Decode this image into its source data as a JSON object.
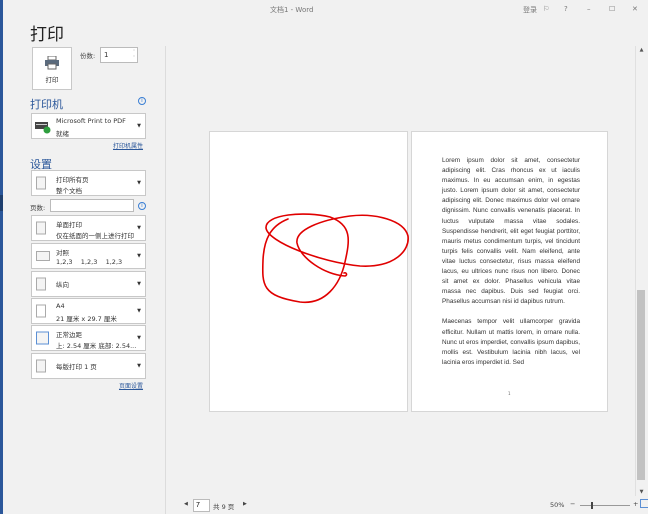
{
  "window": {
    "title": "文档1 - Word",
    "signin": "登录",
    "help": "?",
    "minimize": "–",
    "maximize": "☐",
    "close": "✕"
  },
  "page_title": "打印",
  "print_button": {
    "label": "打印",
    "icon": "printer-icon"
  },
  "copies": {
    "label": "份数:",
    "value": "1"
  },
  "printer": {
    "heading": "打印机",
    "name": "Microsoft Print to PDF",
    "status": "就绪",
    "properties_link": "打印机属性"
  },
  "settings": {
    "heading": "设置",
    "pages_label": "页数:",
    "pages_value": "",
    "items": [
      {
        "line1": "打印所有页",
        "line2": "整个文档"
      },
      {
        "line1": "单面打印",
        "line2": "仅在纸面的一侧上进行打印"
      },
      {
        "line1": "对照",
        "line2": "1,2,3    1,2,3    1,2,3"
      },
      {
        "line1": "纵向",
        "line2": ""
      },
      {
        "line1": "A4",
        "line2": "21 厘米 x 29.7 厘米"
      },
      {
        "line1": "正常边距",
        "line2": "上: 2.54 厘米 底部: 2.54..."
      },
      {
        "line1": "每版打印 1 页",
        "line2": ""
      }
    ],
    "page_setup_link": "页面设置"
  },
  "preview": {
    "paragraphs": [
      "Lorem ipsum dolor sit amet, consectetur adipiscing elit. Cras rhoncus ex ut iaculis maximus. In eu accumsan enim, in egestas justo. Lorem ipsum dolor sit amet, consectetur adipiscing elit. Donec maximus dolor vel ornare dignissim. Nunc convallis venenatis placerat. In luctus vulputate massa vitae sodales. Suspendisse hendrerit, elit eget feugiat porttitor, mauris metus condimentum turpis, vel tincidunt turpis felis convallis velit. Nam eleifend, ante vitae luctus consectetur, risus massa eleifend lacus, eu ultrices nunc risus non libero. Donec sit amet ex dolor. Phasellus vehicula vitae massa nec dapibus. Duis sed feugiat orci. Phasellus accumsan nisi id dapibus rutrum.",
      "Maecenas tempor velit ullamcorper gravida efficitur. Nullam ut mattis lorem, in ornare nulla. Nunc ut eros imperdiet, convallis ipsum dapibus, mollis est. Vestibulum lacinia nibh lacus, vel lacinia eros imperdiet id. Sed"
    ],
    "page_number": "1",
    "ink_color": "#e00000"
  },
  "status": {
    "current_page": "7",
    "total": "共 9 页",
    "zoom": "50%"
  },
  "colors": {
    "accent": "#2b579a"
  }
}
